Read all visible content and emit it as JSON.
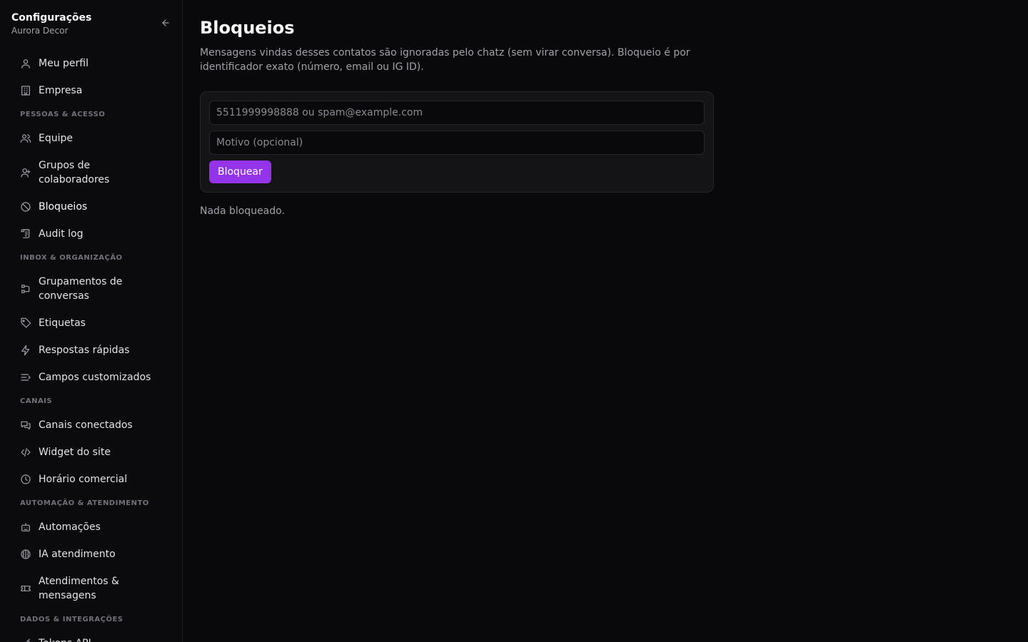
{
  "sidebar": {
    "title": "Configurações",
    "subtitle": "Aurora Decor",
    "items": [
      {
        "type": "item",
        "name": "sidebar-item-meu-perfil",
        "icon": "user-icon",
        "label": "Meu perfil"
      },
      {
        "type": "item",
        "name": "sidebar-item-empresa",
        "icon": "building-icon",
        "label": "Empresa"
      },
      {
        "type": "section",
        "name": "section-pessoas-acesso",
        "label": "PESSOAS & ACESSO"
      },
      {
        "type": "item",
        "name": "sidebar-item-equipe",
        "icon": "users-icon",
        "label": "Equipe"
      },
      {
        "type": "item",
        "name": "sidebar-item-grupos",
        "icon": "user-group-icon",
        "label": "Grupos de colaboradores",
        "two": true
      },
      {
        "type": "item",
        "name": "sidebar-item-bloqueios",
        "icon": "ban-icon",
        "label": "Bloqueios",
        "active": true
      },
      {
        "type": "item",
        "name": "sidebar-item-audit-log",
        "icon": "scroll-icon",
        "label": "Audit log"
      },
      {
        "type": "section",
        "name": "section-inbox-organizacao",
        "label": "INBOX & ORGANIZAÇÃO"
      },
      {
        "type": "item",
        "name": "sidebar-item-grupamentos",
        "icon": "git-branch-icon",
        "label": "Grupamentos de conversas",
        "two": true
      },
      {
        "type": "item",
        "name": "sidebar-item-etiquetas",
        "icon": "tag-icon",
        "label": "Etiquetas"
      },
      {
        "type": "item",
        "name": "sidebar-item-respostas",
        "icon": "zap-icon",
        "label": "Respostas rápidas"
      },
      {
        "type": "item",
        "name": "sidebar-item-campos",
        "icon": "list-icon",
        "label": "Campos customizados"
      },
      {
        "type": "section",
        "name": "section-canais",
        "label": "CANAIS"
      },
      {
        "type": "item",
        "name": "sidebar-item-canais",
        "icon": "messages-icon",
        "label": "Canais conectados"
      },
      {
        "type": "item",
        "name": "sidebar-item-widget",
        "icon": "code-icon",
        "label": "Widget do site"
      },
      {
        "type": "item",
        "name": "sidebar-item-horario",
        "icon": "clock-icon",
        "label": "Horário comercial"
      },
      {
        "type": "section",
        "name": "section-automacao",
        "label": "AUTOMAÇÃO & ATENDIMENTO"
      },
      {
        "type": "item",
        "name": "sidebar-item-automacoes",
        "icon": "bot-icon",
        "label": "Automações"
      },
      {
        "type": "item",
        "name": "sidebar-item-ia",
        "icon": "brain-icon",
        "label": "IA atendimento"
      },
      {
        "type": "item",
        "name": "sidebar-item-atendimentos",
        "icon": "ticket-icon",
        "label": "Atendimentos & mensagens",
        "two": true
      },
      {
        "type": "section",
        "name": "section-dados",
        "label": "DADOS & INTEGRAÇÕES"
      },
      {
        "type": "item",
        "name": "sidebar-item-tokens",
        "icon": "key-icon",
        "label": "Tokens API"
      }
    ]
  },
  "main": {
    "title": "Bloqueios",
    "description": "Mensagens vindas desses contatos são ignoradas pelo chatz (sem virar conversa). Bloqueio é por identificador exato (número, email ou IG ID).",
    "form": {
      "identifier_placeholder": "5511999998888 ou spam@example.com",
      "reason_placeholder": "Motivo (opcional)",
      "submit_label": "Bloquear"
    },
    "empty_text": "Nada bloqueado."
  },
  "colors": {
    "background": "#09090b",
    "sidebar": "#0b0b0e",
    "card": "#141417",
    "accent": "#9333ea"
  }
}
